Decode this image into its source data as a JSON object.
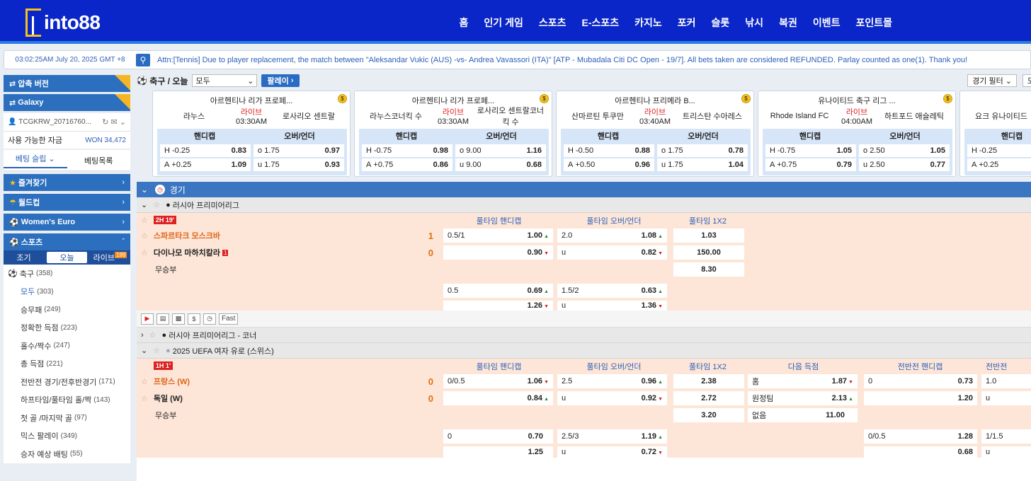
{
  "header": {
    "logo": "into88",
    "nav": [
      "홈",
      "인기 게임",
      "스포츠",
      "E-스포츠",
      "카지노",
      "포커",
      "슬롯",
      "낚시",
      "복권",
      "이벤트",
      "포인트몰"
    ]
  },
  "ticker": {
    "time": "03:02:25AM July 20, 2025 GMT +8",
    "message": "Attn:[Tennis] Due to player replacement, the match between \"Aleksandar Vukic (AUS) -vs- Andrea Vavassori (ITA)\" [ATP - Mubadala Citi DC Open - 19/7]. All bets taken are considered REFUNDED. Parlay counted as one(1). Thank you!"
  },
  "sidebar": {
    "promo1": "압축 버전",
    "promo2": "Galaxy",
    "new": "NEW",
    "user": "TCGKRW_20716760...",
    "funds_label": "사용 가능한 자금",
    "funds_value": "WON 34,472",
    "slip_tab": "베팅 슬립",
    "list_tab": "베팅목록",
    "favorites": "즐겨찾기",
    "worldcup": "월드컵",
    "womens_euro": "Women's Euro",
    "sports": "스포츠",
    "subtabs": [
      "조기",
      "오늘",
      "라이브"
    ],
    "live_count": "199",
    "soccer": "축구",
    "soccer_count": "(358)",
    "items": [
      {
        "label": "모두",
        "count": "(303)"
      },
      {
        "label": "승무패",
        "count": "(249)"
      },
      {
        "label": "정확한 득점",
        "count": "(223)"
      },
      {
        "label": "홀수/짝수",
        "count": "(247)"
      },
      {
        "label": "총 득점",
        "count": "(221)"
      },
      {
        "label": "전반전 경기/전후반경기",
        "count": "(171)"
      },
      {
        "label": "하프타임/풀타임 홀/짝",
        "count": "(143)"
      },
      {
        "label": "첫 골 /마지막 골",
        "count": "(97)"
      },
      {
        "label": "믹스 팔레이",
        "count": "(349)"
      },
      {
        "label": "승자 예상 배팅",
        "count": "(55)"
      }
    ]
  },
  "filter": {
    "title": "축구 / 오늘",
    "select": "모두",
    "parlay": "팔레이",
    "match_filter": "경기 필터",
    "more": "모"
  },
  "cards": [
    {
      "league": "아르헨티나 리가 프로페...",
      "home": "라누스",
      "away": "로사리오 센트랄",
      "status": "라이브",
      "time": "03:30AM",
      "h_line": "-0.25",
      "h_odds": "0.83",
      "a_line": "+0.25",
      "a_odds": "1.09",
      "o_line": "1.75",
      "o_odds": "0.97",
      "u_line": "1.75",
      "u_odds": "0.93"
    },
    {
      "league": "아르헨티나 리가 프로페...",
      "home": "라누스코너킥 수",
      "away": "로사리오 센트랄코너킥 수",
      "status": "라이브",
      "time": "03:30AM",
      "h_line": "-0.75",
      "h_odds": "0.98",
      "a_line": "+0.75",
      "a_odds": "0.86",
      "o_line": "9.00",
      "o_odds": "1.16",
      "u_line": "9.00",
      "u_odds": "0.68"
    },
    {
      "league": "아르헨티나 프리메라 B...",
      "home": "산마르틴 투쿠만",
      "away": "트리스탄 수아레스",
      "status": "라이브",
      "time": "03:40AM",
      "h_line": "-0.50",
      "h_odds": "0.88",
      "a_line": "+0.50",
      "a_odds": "0.96",
      "o_line": "1.75",
      "o_odds": "0.78",
      "u_line": "1.75",
      "u_odds": "1.04"
    },
    {
      "league": "유나이티드 축구 리그 ...",
      "home": "Rhode Island FC",
      "away": "하트포드 애슬레틱",
      "status": "라이브",
      "time": "04:00AM",
      "h_line": "-0.75",
      "h_odds": "1.05",
      "a_line": "+0.75",
      "a_odds": "0.79",
      "o_line": "2.50",
      "o_odds": "1.05",
      "u_line": "2.50",
      "u_odds": "0.77"
    },
    {
      "league": "캐",
      "home": "요크 유나이티드",
      "away": "",
      "status": "",
      "time": "",
      "h_line": "-0.25",
      "h_odds": "",
      "a_line": "+0.25",
      "a_odds": "",
      "o_line": "",
      "o_odds": "",
      "u_line": "",
      "u_odds": ""
    }
  ],
  "market_labels": {
    "hdp": "핸디캡",
    "ou": "오버/언더",
    "h": "H",
    "a": "A",
    "o": "o",
    "u": "u"
  },
  "main": {
    "bar_title": "경기",
    "league1": "러시아 프리미어리그",
    "league2": "러시아 프리미어리그 - 코너",
    "league3": "2025 UEFA 여자 유로 (스위스)",
    "cols": {
      "ft_hdp": "풀타임 핸디캡",
      "ft_ou": "풀타임 오버/언더",
      "ft_1x2": "풀타임 1X2",
      "next_goal": "다음 득점",
      "ht_hdp": "전반전 핸디캡",
      "ht_more": "전반전"
    },
    "draw": "무승부",
    "fast": "Fast",
    "m1": {
      "clock": "2H 19'",
      "home": "스파르타크 모스크바",
      "home_score": "1",
      "away": "다이나모 마하치칼라",
      "away_red": "1",
      "away_score": "0",
      "r1": {
        "hdp_line": "0.5/1",
        "hdp_h": "1.00",
        "ou_line": "2.0",
        "ou_o": "1.08",
        "x1": "1.03"
      },
      "r2": {
        "hdp_a": "0.90",
        "ou_u_label": "u",
        "ou_u": "0.82",
        "x2": "150.00"
      },
      "r3": {
        "xd": "8.30"
      },
      "r4": {
        "hdp_line": "0.5",
        "hdp_h": "0.69",
        "ou_line": "1.5/2",
        "ou_o": "0.63"
      },
      "r5": {
        "hdp_a": "1.26",
        "ou_u_label": "u",
        "ou_u": "1.36"
      }
    },
    "m2": {
      "clock": "1H 1'",
      "home": "프랑스 (W)",
      "home_score": "0",
      "away": "독일 (W)",
      "away_score": "0",
      "r1": {
        "hdp_line": "0/0.5",
        "hdp_h": "1.06",
        "ou_line": "2.5",
        "ou_o": "0.96",
        "x1": "2.38",
        "ng_l": "홈",
        "ng_v": "1.87",
        "hh_line": "0",
        "hh_v": "0.73",
        "hm_line": "1.0"
      },
      "r2": {
        "hdp_a": "0.84",
        "ou_u_label": "u",
        "ou_u": "0.92",
        "x2": "2.72",
        "ng_l": "원정팀",
        "ng_v": "2.13",
        "hh_v": "1.20",
        "hm_line": "u"
      },
      "r3": {
        "xd": "3.20",
        "ng_l": "없음",
        "ng_v": "11.00"
      },
      "r4": {
        "hdp_line": "0",
        "hdp_h": "0.70",
        "ou_line": "2.5/3",
        "ou_o": "1.19",
        "hh_line": "0/0.5",
        "hh_v": "1.28",
        "hm_line": "1/1.5"
      },
      "r5": {
        "hdp_a": "1.25",
        "ou_u_label": "u",
        "ou_u": "0.72",
        "hh_v": "0.68",
        "hm_line": "u"
      }
    }
  },
  "colors": {
    "header": "#0a26c8",
    "accent": "#2c6fbf",
    "live": "#e02020",
    "home_team": "#e06418"
  }
}
